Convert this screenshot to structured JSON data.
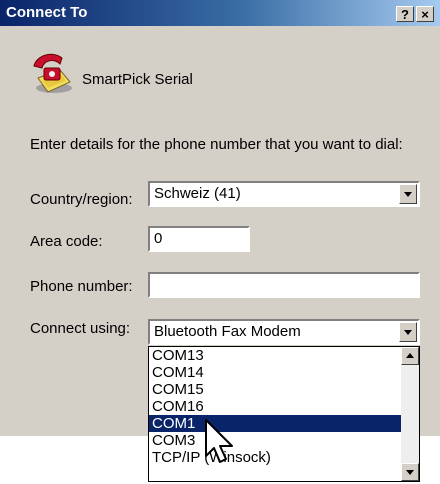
{
  "window": {
    "title": "Connect To",
    "help_button": "?",
    "close_button": "×"
  },
  "connection": {
    "name": "SmartPick Serial"
  },
  "instructions": "Enter details for the phone number that you want to dial:",
  "form": {
    "country_label": "Country/region:",
    "country_value": "Schweiz (41)",
    "area_code_label": "Area code:",
    "area_code_value": "0",
    "phone_label": "Phone number:",
    "phone_value": "",
    "connect_using_label": "Connect using:",
    "connect_using_value": "Bluetooth Fax Modem"
  },
  "dropdown_list": {
    "items": [
      "COM13",
      "COM14",
      "COM15",
      "COM16",
      "COM1",
      "COM3",
      "TCP/IP (Winsock)"
    ],
    "selected": "COM1"
  },
  "icons": [
    "phone-icon",
    "mouse-pointer-icon"
  ],
  "colors": {
    "title_bar": "#0a246a",
    "selection": "#0a246a",
    "dialog_face": "#d4d0c8"
  }
}
